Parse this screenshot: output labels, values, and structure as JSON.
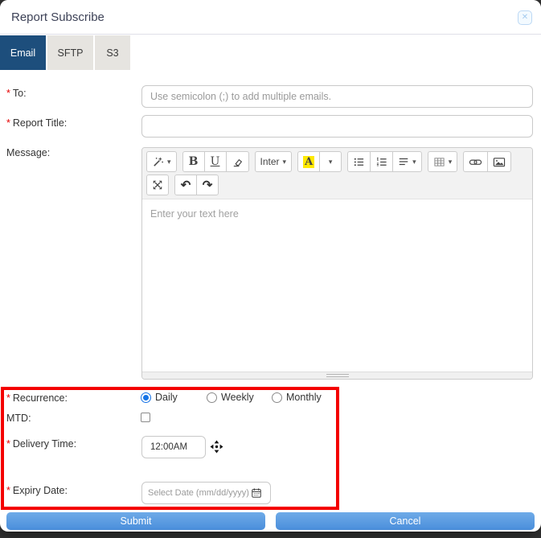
{
  "misc": {
    "required_marker": "*"
  },
  "icons": {
    "close": "✕",
    "caret": "▾",
    "bold_letter": "B",
    "underline_letter": "U",
    "font_color_letter": "A",
    "undo": "↶",
    "redo": "↷"
  },
  "colors": {
    "backdrop": "#333333",
    "tab_active_bg": "#1d4e7c",
    "tab_inactive_bg": "#e6e4e0",
    "highlight_red": "#f40000",
    "button_blue": "#4f92dc",
    "radio_selected_blue": "#1673e6",
    "required_red": "#e60000"
  },
  "modal": {
    "title": "Report Subscribe"
  },
  "tabs": [
    {
      "label": "Email",
      "active": true
    },
    {
      "label": "SFTP",
      "active": false
    },
    {
      "label": "S3",
      "active": false
    }
  ],
  "form": {
    "to": {
      "label": "To:",
      "required": true,
      "value": "",
      "placeholder": "Use semicolon (;) to add multiple emails."
    },
    "report_title": {
      "label": "Report Title:",
      "required": true,
      "value": "",
      "placeholder": ""
    },
    "message": {
      "label": "Message:",
      "required": false
    },
    "recurrence": {
      "label": "Recurrence:",
      "required": true,
      "options": [
        {
          "label": "Daily",
          "selected": true
        },
        {
          "label": "Weekly",
          "selected": false
        },
        {
          "label": "Monthly",
          "selected": false
        }
      ]
    },
    "mtd": {
      "label": "MTD:",
      "checked": false
    },
    "delivery_time": {
      "label": "Delivery Time:",
      "required": true,
      "value": "12:00AM"
    },
    "expiry_date": {
      "label": "Expiry Date:",
      "required": true,
      "placeholder": "Select Date (mm/dd/yyyy)"
    }
  },
  "editor": {
    "font_name": "Inter",
    "placeholder": "Enter your text here",
    "toolbar_row1": [
      "magic-style-icon",
      "bold-icon",
      "underline-icon",
      "eraser-icon",
      "font-family-dropdown",
      "font-color-icon",
      "unordered-list-icon",
      "ordered-list-icon",
      "paragraph-align-icon",
      "table-icon",
      "link-icon",
      "picture-icon"
    ],
    "toolbar_row2": [
      "fullscreen-icon",
      "undo-icon",
      "redo-icon"
    ]
  },
  "footer": {
    "submit_label": "Submit",
    "cancel_label": "Cancel"
  }
}
